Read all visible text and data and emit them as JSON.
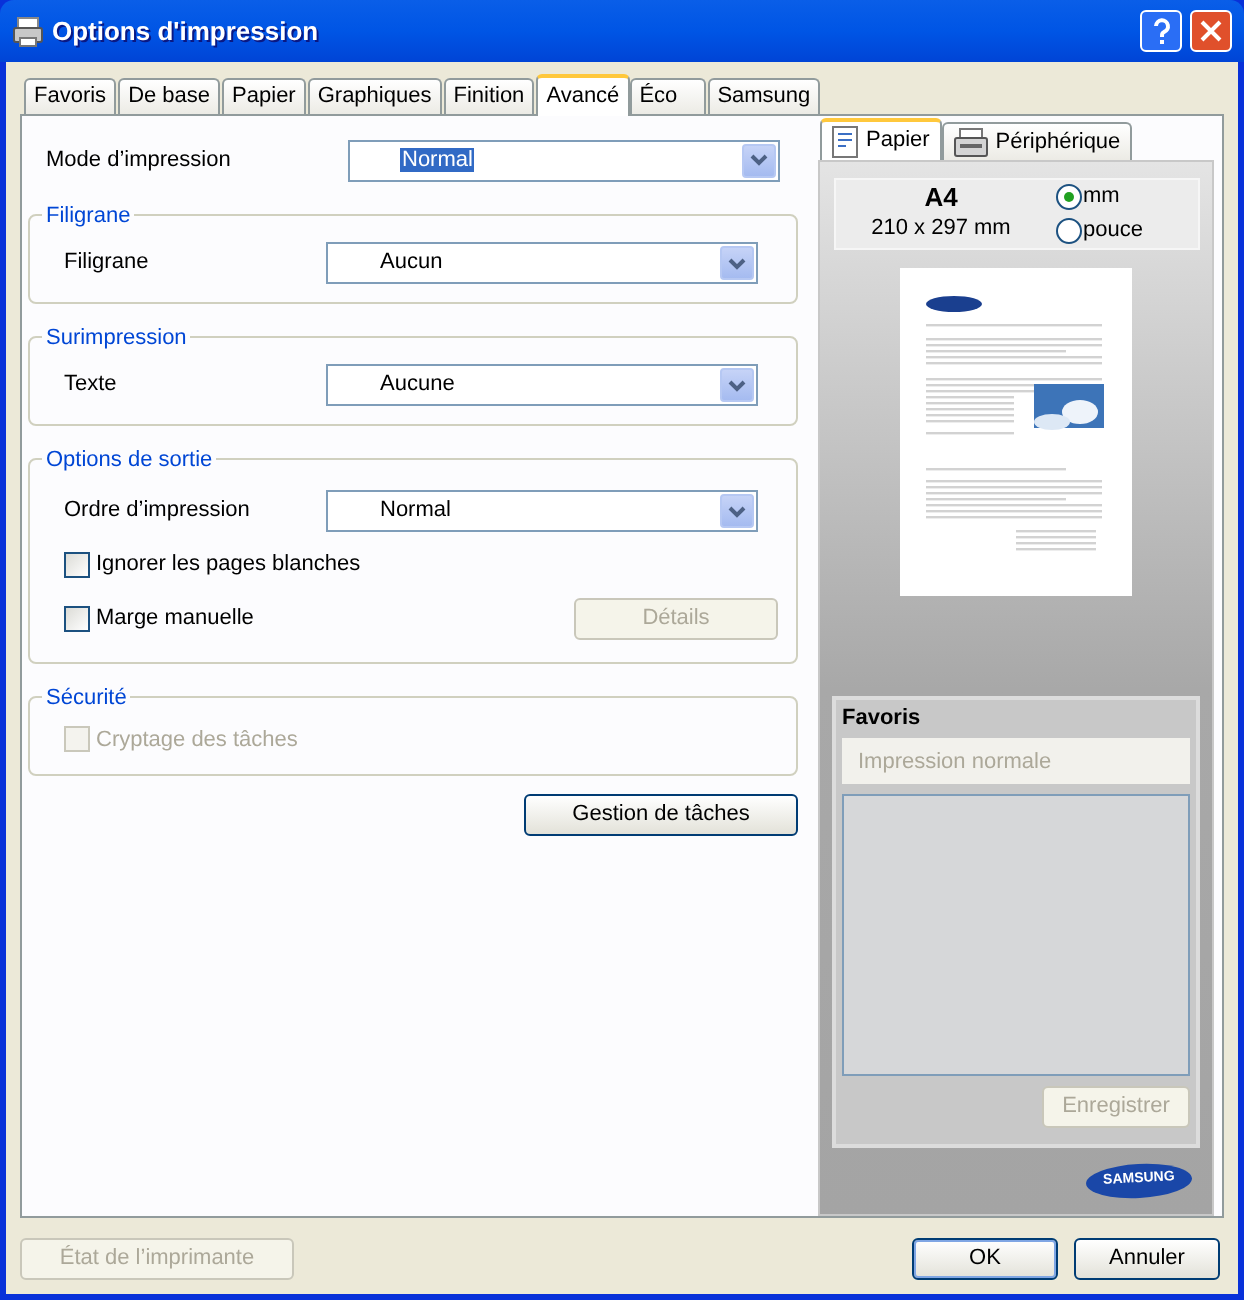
{
  "window": {
    "title": "Options d'impression"
  },
  "tabs": [
    {
      "label": "Favoris",
      "selected": false
    },
    {
      "label": "De base",
      "selected": false
    },
    {
      "label": "Papier",
      "selected": false
    },
    {
      "label": "Graphiques",
      "selected": false
    },
    {
      "label": "Finition",
      "selected": false
    },
    {
      "label": "Avancé",
      "selected": true
    },
    {
      "label": "Éco",
      "selected": false
    },
    {
      "label": "Samsung",
      "selected": false
    }
  ],
  "print_mode": {
    "label": "Mode d’impression",
    "value": "Normal",
    "focused": true
  },
  "groups": [
    {
      "title": "Filigrane",
      "rows": [
        {
          "kind": "select",
          "label": "Filigrane",
          "value": "Aucun"
        }
      ]
    },
    {
      "title": "Surimpression",
      "rows": [
        {
          "kind": "select",
          "label": "Texte",
          "value": "Aucune"
        }
      ]
    },
    {
      "title": "Options de sortie",
      "rows": [
        {
          "kind": "select",
          "label": "Ordre d’impression",
          "value": "Normal"
        },
        {
          "kind": "checkbox",
          "label": "Ignorer les pages blanches",
          "checked": false,
          "disabled": false
        },
        {
          "kind": "checkbox",
          "label": "Marge manuelle",
          "checked": false,
          "disabled": false,
          "button": {
            "label": "Détails",
            "disabled": true
          }
        }
      ]
    },
    {
      "title": "Sécurité",
      "rows": [
        {
          "kind": "checkbox",
          "label": "Cryptage des tâches",
          "checked": false,
          "disabled": true
        }
      ]
    }
  ],
  "job_button": "Gestion de tâches",
  "preview": {
    "tabs": [
      {
        "label": "Papier",
        "selected": true
      },
      {
        "label": "Périphérique",
        "selected": false
      }
    ],
    "paper_size": "A4",
    "dimensions": "210 x 297 mm",
    "units": [
      {
        "label": "mm",
        "selected": true
      },
      {
        "label": "pouce",
        "selected": false
      }
    ]
  },
  "favorites": {
    "title": "Favoris",
    "placeholder": "Impression normale",
    "save_button": {
      "label": "Enregistrer",
      "disabled": true
    }
  },
  "logo": "SAMSUNG",
  "footer": {
    "printer_status": {
      "label": "État de l’imprimante",
      "disabled": true
    },
    "ok": "OK",
    "cancel": "Annuler"
  }
}
